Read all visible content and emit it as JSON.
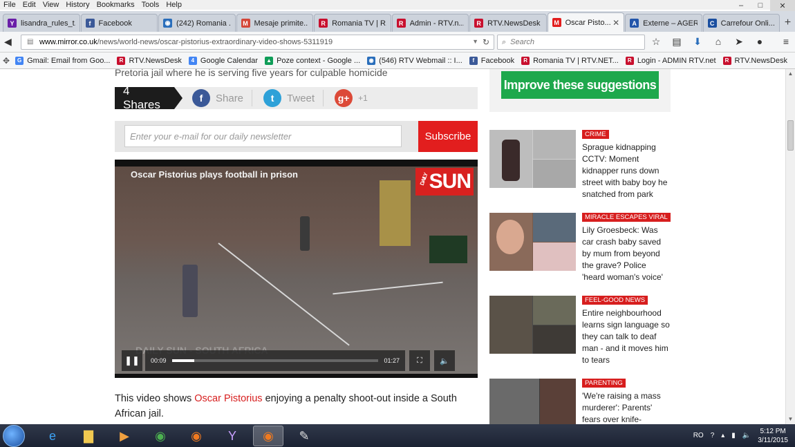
{
  "menu": [
    "File",
    "Edit",
    "View",
    "History",
    "Bookmarks",
    "Tools",
    "Help"
  ],
  "window_controls": {
    "minimize": "–",
    "maximize": "□",
    "close": "✕"
  },
  "tabs": [
    {
      "label": "lisandra_rules_t...",
      "fav": "Y",
      "color": "#6a1fa8"
    },
    {
      "label": "Facebook",
      "fav": "f",
      "color": "#3b5998"
    },
    {
      "label": "(242) Romania ...",
      "fav": "◉",
      "color": "#2a6ebb"
    },
    {
      "label": "Mesaje primite...",
      "fav": "M",
      "color": "#d44638"
    },
    {
      "label": "Romania TV | R...",
      "fav": "R",
      "color": "#c8102e"
    },
    {
      "label": "Admin - RTV.n...",
      "fav": "R",
      "color": "#c8102e"
    },
    {
      "label": "RTV.NewsDesk",
      "fav": "R",
      "color": "#c8102e"
    },
    {
      "label": "Oscar Pisto...",
      "fav": "M",
      "color": "#e21e1e",
      "active": true
    },
    {
      "label": "Externe – AGER...",
      "fav": "A",
      "color": "#2255aa"
    },
    {
      "label": "Carrefour Onli...",
      "fav": "C",
      "color": "#1b4fa0"
    }
  ],
  "url": {
    "host": "www.mirror.co.uk",
    "path": "/news/world-news/oscar-pistorius-extraordinary-video-shows-5311919"
  },
  "search": {
    "placeholder": "Search"
  },
  "bookmarks": [
    {
      "label": "Gmail: Email from Goo...",
      "fav": "G",
      "color": "#4285f4"
    },
    {
      "label": "RTV.NewsDesk",
      "fav": "R",
      "color": "#c8102e"
    },
    {
      "label": "Google Calendar",
      "fav": "4",
      "color": "#4285f4"
    },
    {
      "label": "Poze context - Google ...",
      "fav": "▲",
      "color": "#0f9d58"
    },
    {
      "label": "(546) RTV Webmail :: I...",
      "fav": "◉",
      "color": "#2a6ebb"
    },
    {
      "label": "Facebook",
      "fav": "f",
      "color": "#3b5998"
    },
    {
      "label": "Romania TV | RTV.NET...",
      "fav": "R",
      "color": "#c8102e"
    },
    {
      "label": "Login - ADMIN RTV.net",
      "fav": "R",
      "color": "#c8102e"
    },
    {
      "label": "RTV.NewsDesk",
      "fav": "R",
      "color": "#c8102e"
    }
  ],
  "article": {
    "subhead": "Pretoria jail where he is serving five years for culpable homicide",
    "shares": "4 Shares",
    "share_fb": "Share",
    "share_tw": "Tweet",
    "share_gp": "+1",
    "newsletter_placeholder": "Enter your e-mail for our daily newsletter",
    "subscribe": "Subscribe",
    "video": {
      "title": "Oscar Pistorius plays football in prison",
      "logo": "SUN",
      "logo_small": "DAILY",
      "watermark": "DAILY SUN - SOUTH AFRICA",
      "current_time": "00:09",
      "duration": "01:27",
      "progress": 0.11
    },
    "body_before_link": "This video shows ",
    "body_link": "Oscar Pistorius",
    "body_after_link": " enjoying a penalty shoot-out inside a South African jail."
  },
  "sidebar": {
    "improve": "Improve these suggestions",
    "items": [
      {
        "tag": "Crime",
        "headline": "Sprague kidnapping CCTV: Moment kidnapper runs down street with baby boy he snatched from park"
      },
      {
        "tag": "Miracle escapes viral",
        "headline": "Lily Groesbeck: Was car crash baby saved by mum from beyond the grave? Police 'heard woman's voice'"
      },
      {
        "tag": "Feel-good news",
        "headline": "Entire neighbourhood learns sign language so they can talk to deaf man - and it moves him to tears"
      },
      {
        "tag": "Parenting",
        "headline": "'We're raising a mass murderer': Parents' fears over knife-obsessed son"
      }
    ]
  },
  "taskbar": {
    "lang": "RO",
    "time": "5:12 PM",
    "date": "3/11/2015"
  }
}
